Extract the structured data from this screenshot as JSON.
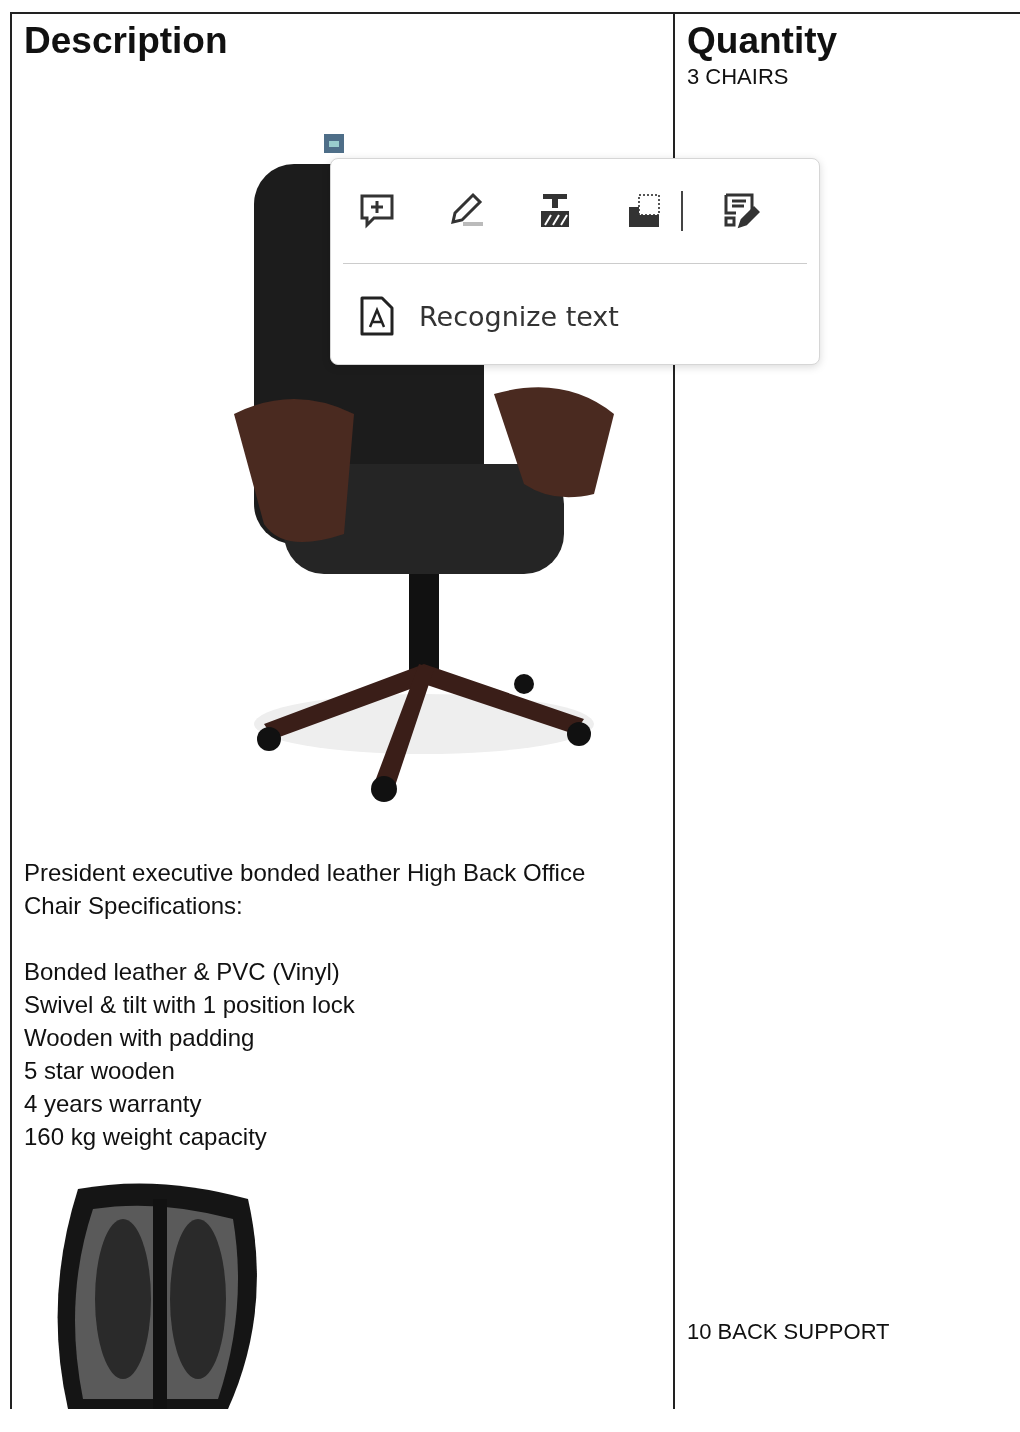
{
  "table": {
    "columns": [
      {
        "heading": "Description"
      },
      {
        "heading": "Quantity"
      }
    ],
    "rows": [
      {
        "kind": "chair",
        "quantity": "3 CHAIRS",
        "intro": "President executive bonded leather High Back Office Chair Specifications:",
        "specs": [
          "Bonded leather & PVC (Vinyl)",
          "Swivel & tilt with 1 position lock",
          "Wooden with padding",
          "5 star wooden",
          "4 years warranty",
          "160 kg weight capacity"
        ]
      },
      {
        "kind": "support",
        "quantity": "10 BACK SUPPORT"
      }
    ]
  },
  "popup": {
    "menu_items": [
      {
        "label": "Recognize text"
      }
    ]
  }
}
